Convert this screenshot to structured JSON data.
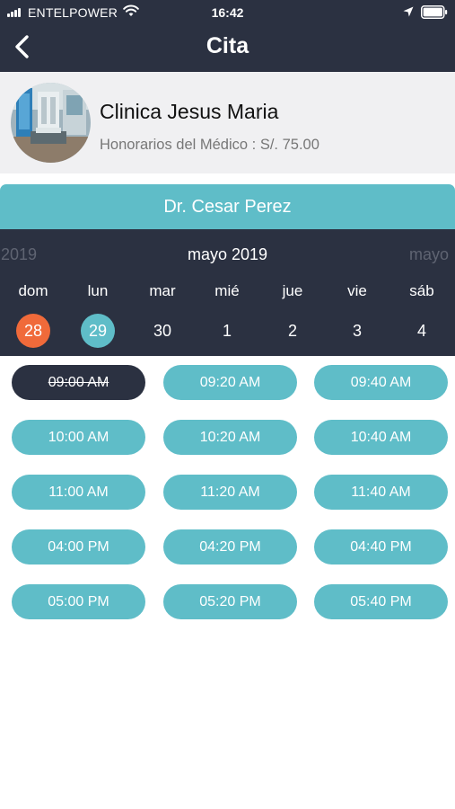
{
  "status_bar": {
    "carrier": "ENTELPOWER",
    "time": "16:42"
  },
  "nav": {
    "title": "Cita"
  },
  "clinic": {
    "name": "Clinica Jesus Maria",
    "fee": "Honorarios del Médico : S/. 75.00"
  },
  "doctor": {
    "name": "Dr. Cesar Perez"
  },
  "calendar": {
    "prev_label": "2019",
    "month": "mayo 2019",
    "next_label": "mayo",
    "days": [
      {
        "weekday": "dom",
        "date": "28"
      },
      {
        "weekday": "lun",
        "date": "29"
      },
      {
        "weekday": "mar",
        "date": "30"
      },
      {
        "weekday": "mié",
        "date": "1"
      },
      {
        "weekday": "jue",
        "date": "2"
      },
      {
        "weekday": "vie",
        "date": "3"
      },
      {
        "weekday": "sáb",
        "date": "4"
      }
    ]
  },
  "slots": [
    "09:00 AM",
    "09:20 AM",
    "09:40 AM",
    "10:00 AM",
    "10:20 AM",
    "10:40 AM",
    "11:00 AM",
    "11:20 AM",
    "11:40 AM",
    "04:00 PM",
    "04:20 PM",
    "04:40 PM",
    "05:00 PM",
    "05:20 PM",
    "05:40 PM"
  ],
  "colors": {
    "header_bg": "#2b3141",
    "accent": "#5fbdc8",
    "today": "#f06a3a",
    "card_bg": "#f0f0f2"
  }
}
